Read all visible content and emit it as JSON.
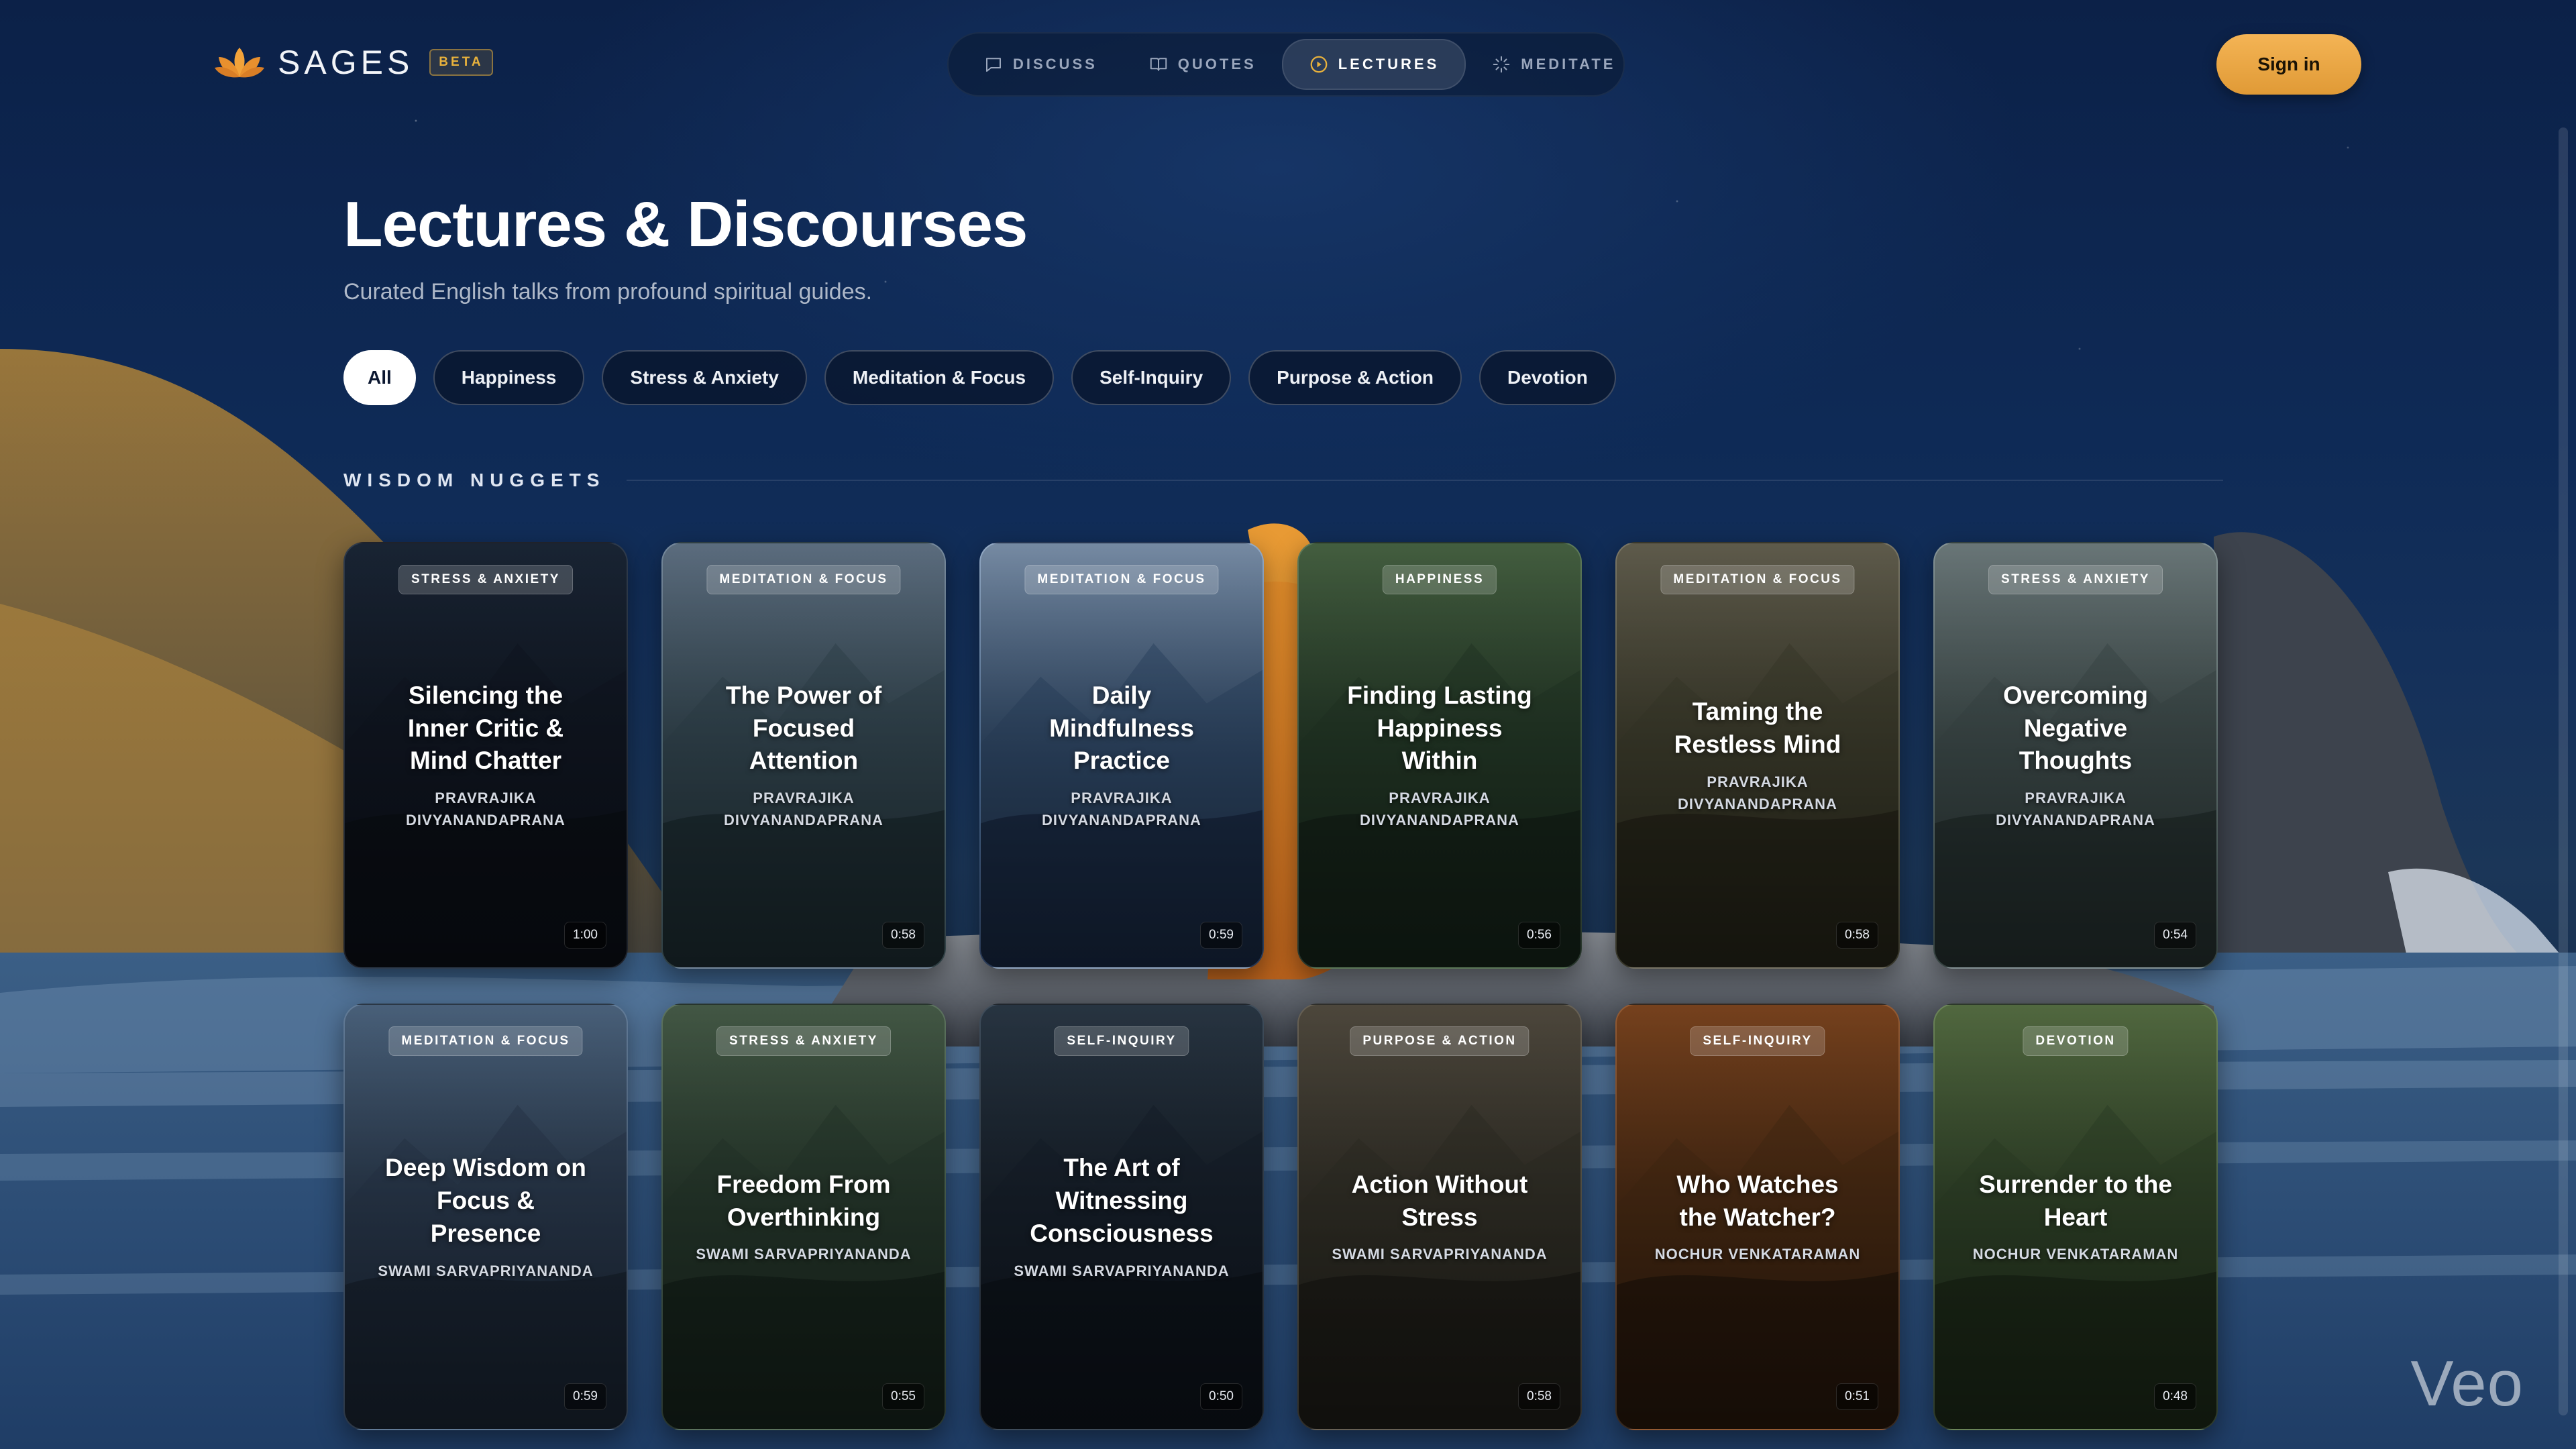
{
  "brand": {
    "name": "SAGES",
    "badge": "BETA"
  },
  "nav": {
    "items": [
      {
        "label": "DISCUSS",
        "icon": "chat-bubble-icon",
        "active": false
      },
      {
        "label": "QUOTES",
        "icon": "book-open-icon",
        "active": false
      },
      {
        "label": "LECTURES",
        "icon": "play-circle-icon",
        "active": true
      },
      {
        "label": "MEDITATE",
        "icon": "sparkle-icon",
        "active": false
      }
    ]
  },
  "auth": {
    "signin_label": "Sign in"
  },
  "page": {
    "title": "Lectures & Discourses",
    "subtitle": "Curated English talks from profound spiritual guides."
  },
  "filters": [
    "All",
    "Happiness",
    "Stress & Anxiety",
    "Meditation & Focus",
    "Self-Inquiry",
    "Purpose & Action",
    "Devotion"
  ],
  "active_filter": "All",
  "section": {
    "title": "WISDOM NUGGETS"
  },
  "cards": [
    {
      "tag": "STRESS & ANXIETY",
      "title": "Silencing the Inner Critic & Mind Chatter",
      "author": "PRAVRAJIKA DIVYANANDAPRANA",
      "duration": "1:00",
      "theme": "night"
    },
    {
      "tag": "MEDITATION & FOCUS",
      "title": "The Power of Focused Attention",
      "author": "PRAVRAJIKA DIVYANANDAPRANA",
      "duration": "0:58",
      "theme": "mountain-lake"
    },
    {
      "tag": "MEDITATION & FOCUS",
      "title": "Daily Mindfulness Practice",
      "author": "PRAVRAJIKA DIVYANANDAPRANA",
      "duration": "0:59",
      "theme": "lotus"
    },
    {
      "tag": "HAPPINESS",
      "title": "Finding Lasting Happiness Within",
      "author": "PRAVRAJIKA DIVYANANDAPRANA",
      "duration": "0:56",
      "theme": "forest"
    },
    {
      "tag": "MEDITATION & FOCUS",
      "title": "Taming the Restless Mind",
      "author": "PRAVRAJIKA DIVYANANDAPRANA",
      "duration": "0:58",
      "theme": "leaf"
    },
    {
      "tag": "STRESS & ANXIETY",
      "title": "Overcoming Negative Thoughts",
      "author": "PRAVRAJIKA DIVYANANDAPRANA",
      "duration": "0:54",
      "theme": "valley"
    },
    {
      "tag": "MEDITATION & FOCUS",
      "title": "Deep Wisdom on Focus & Presence",
      "author": "SWAMI SARVAPRIYANANDA",
      "duration": "0:59",
      "theme": "peak"
    },
    {
      "tag": "STRESS & ANXIETY",
      "title": "Freedom From Overthinking",
      "author": "SWAMI SARVAPRIYANANDA",
      "duration": "0:55",
      "theme": "waterfall"
    },
    {
      "tag": "SELF-INQUIRY",
      "title": "The Art of Witnessing Consciousness",
      "author": "SWAMI SARVAPRIYANANDA",
      "duration": "0:50",
      "theme": "water-drop"
    },
    {
      "tag": "PURPOSE & ACTION",
      "title": "Action Without Stress",
      "author": "SWAMI SARVAPRIYANANDA",
      "duration": "0:58",
      "theme": "autumn-leaves"
    },
    {
      "tag": "SELF-INQUIRY",
      "title": "Who Watches the Watcher?",
      "author": "NOCHUR VENKATARAMAN",
      "duration": "0:51",
      "theme": "autumn-forest"
    },
    {
      "tag": "DEVOTION",
      "title": "Surrender to the Heart",
      "author": "NOCHUR VENKATARAMAN",
      "duration": "0:48",
      "theme": "green-hills"
    }
  ],
  "watermark": "Veo",
  "colors": {
    "accent": "#e9a640",
    "background": "#0b1730",
    "chip_active": "#ffffff"
  }
}
